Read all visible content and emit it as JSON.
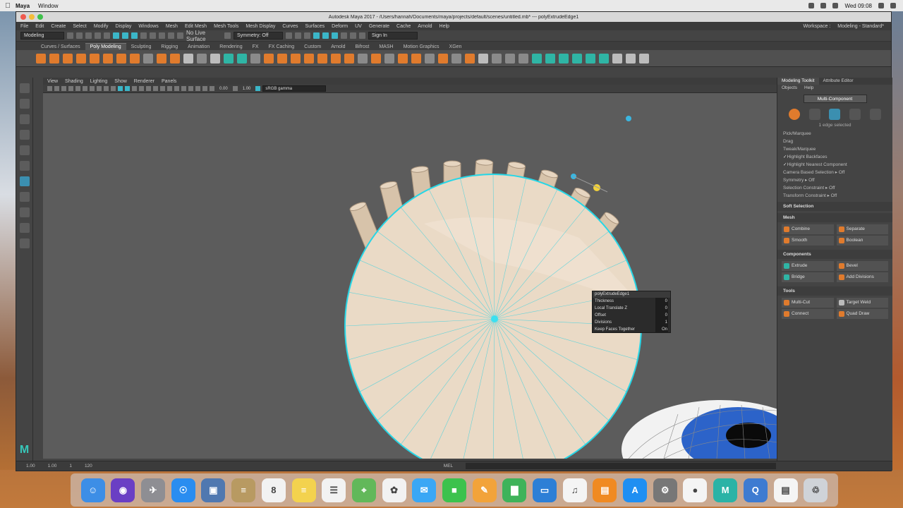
{
  "menubar": {
    "app": "Maya",
    "window": "Window",
    "clock": "Wed 09:08"
  },
  "window": {
    "title": "Autodesk Maya 2017 - /Users/hannah/Documents/maya/projects/default/scenes/untitled.mb* --- polyExtrudeEdge1"
  },
  "main_menu": [
    "File",
    "Edit",
    "Create",
    "Select",
    "Modify",
    "Display",
    "Windows",
    "Mesh",
    "Edit Mesh",
    "Mesh Tools",
    "Mesh Display",
    "Curves",
    "Surfaces",
    "Deform",
    "UV",
    "Generate",
    "Cache",
    "Arnold",
    "Help"
  ],
  "main_menu_right": [
    "Workspace :",
    "Modeling - Standard*"
  ],
  "status_line": {
    "mode": "Modeling",
    "live": "No Live Surface",
    "symmetry": "Symmetry: Off",
    "sign_in": "Sign In"
  },
  "shelf_tabs": [
    "Curves / Surfaces",
    "Poly Modeling",
    "Sculpting",
    "Rigging",
    "Animation",
    "Rendering",
    "FX",
    "FX Caching",
    "Custom",
    "Arnold",
    "Bifrost",
    "MASH",
    "Motion Graphics",
    "XGen"
  ],
  "shelf_active": "Poly Modeling",
  "viewport_menu": [
    "View",
    "Shading",
    "Lighting",
    "Show",
    "Renderer",
    "Panels"
  ],
  "viewport_tools": {
    "value1": "0.00",
    "value2": "1.00",
    "camera": "sRGB gamma"
  },
  "hud": {
    "title": "polyExtrudeEdge1",
    "rows": [
      {
        "label": "Thickness",
        "value": "0"
      },
      {
        "label": "Local Translate Z",
        "value": "0"
      },
      {
        "label": "Offset",
        "value": "0"
      },
      {
        "label": "Divisions",
        "value": "1"
      },
      {
        "label": "Keep Faces Together",
        "value": "On"
      }
    ]
  },
  "right_panel": {
    "tabs": [
      "Modeling Toolkit",
      "Attribute Editor"
    ],
    "sub": [
      "Objects",
      "Help"
    ],
    "multi_button": "Multi-Component",
    "count": "1 edge selected",
    "options": [
      {
        "label": "Pick/Marquee",
        "check": false
      },
      {
        "label": "Drag",
        "check": false
      },
      {
        "label": "Tweak/Marquee",
        "check": false
      },
      {
        "label": "Highlight Backfaces",
        "check": true
      },
      {
        "label": "Highlight Nearest Component",
        "check": true
      },
      {
        "label": "Camera Based Selection  ▸  Off",
        "check": false
      },
      {
        "label": "Symmetry  ▸  Off",
        "check": false
      },
      {
        "label": "Selection Constraint  ▸  Off",
        "check": false
      },
      {
        "label": "Transform Constraint  ▸  Off",
        "check": false
      }
    ],
    "soft_selection": "Soft Selection",
    "sections": [
      {
        "title": "Mesh",
        "items": [
          {
            "label": "Combine",
            "k": "o"
          },
          {
            "label": "Separate",
            "k": "o"
          },
          {
            "label": "Smooth",
            "k": "o"
          },
          {
            "label": "Boolean",
            "k": "o"
          }
        ]
      },
      {
        "title": "Components",
        "items": [
          {
            "label": "Extrude",
            "k": "t"
          },
          {
            "label": "Bevel",
            "k": "o"
          },
          {
            "label": "Bridge",
            "k": "t"
          },
          {
            "label": "Add Divisions",
            "k": "o"
          }
        ]
      },
      {
        "title": "Tools",
        "items": [
          {
            "label": "Multi-Cut",
            "k": "o"
          },
          {
            "label": "Target Weld",
            "k": "w"
          },
          {
            "label": "Connect",
            "k": "o"
          },
          {
            "label": "Quad Draw",
            "k": "o"
          }
        ]
      }
    ]
  },
  "cmdline": {
    "frames": [
      "1.00",
      "1.00",
      "1",
      "120"
    ],
    "mel": "MEL"
  },
  "dock": [
    {
      "name": "finder-icon",
      "bg": "#3d8ee6",
      "glyph": "☺"
    },
    {
      "name": "siri-icon",
      "bg": "#6a3fc4",
      "glyph": "◉"
    },
    {
      "name": "launchpad-icon",
      "bg": "#8e8e93",
      "glyph": "✈"
    },
    {
      "name": "safari-icon",
      "bg": "#2a8df0",
      "glyph": "☉"
    },
    {
      "name": "preview-icon",
      "bg": "#5078b0",
      "glyph": "▣"
    },
    {
      "name": "notes-icon",
      "bg": "#b89a62",
      "glyph": "≡"
    },
    {
      "name": "calendar-icon",
      "bg": "#f2f2f2",
      "glyph": "8"
    },
    {
      "name": "stickies-icon",
      "bg": "#f3d24e",
      "glyph": "≡"
    },
    {
      "name": "reminders-icon",
      "bg": "#f2f2f2",
      "glyph": "☰"
    },
    {
      "name": "maps-icon",
      "bg": "#62b85a",
      "glyph": "⌖"
    },
    {
      "name": "photos-icon",
      "bg": "#f2f2f2",
      "glyph": "✿"
    },
    {
      "name": "messages-icon",
      "bg": "#3aa7f5",
      "glyph": "✉"
    },
    {
      "name": "facetime-icon",
      "bg": "#3cc24d",
      "glyph": "■"
    },
    {
      "name": "pages-icon",
      "bg": "#f2a33a",
      "glyph": "✎"
    },
    {
      "name": "numbers-icon",
      "bg": "#3fb35a",
      "glyph": "▇"
    },
    {
      "name": "keynote-icon",
      "bg": "#2d7fd6",
      "glyph": "▭"
    },
    {
      "name": "itunes-icon",
      "bg": "#f4f4f4",
      "glyph": "♫"
    },
    {
      "name": "books-icon",
      "bg": "#f08a22",
      "glyph": "▤"
    },
    {
      "name": "appstore-icon",
      "bg": "#1f8ff2",
      "glyph": "A"
    },
    {
      "name": "system-preferences-icon",
      "bg": "#777",
      "glyph": "⚙"
    },
    {
      "name": "chrome-icon",
      "bg": "#f4f4f4",
      "glyph": "●"
    },
    {
      "name": "maya-icon",
      "bg": "#2bb3a6",
      "glyph": "M"
    },
    {
      "name": "quicktime-icon",
      "bg": "#3e7bd1",
      "glyph": "Q"
    },
    {
      "name": "document-icon",
      "bg": "#f4f4f4",
      "glyph": "▤"
    },
    {
      "name": "trash-icon",
      "bg": "#cfd3d8",
      "glyph": "♲"
    }
  ]
}
